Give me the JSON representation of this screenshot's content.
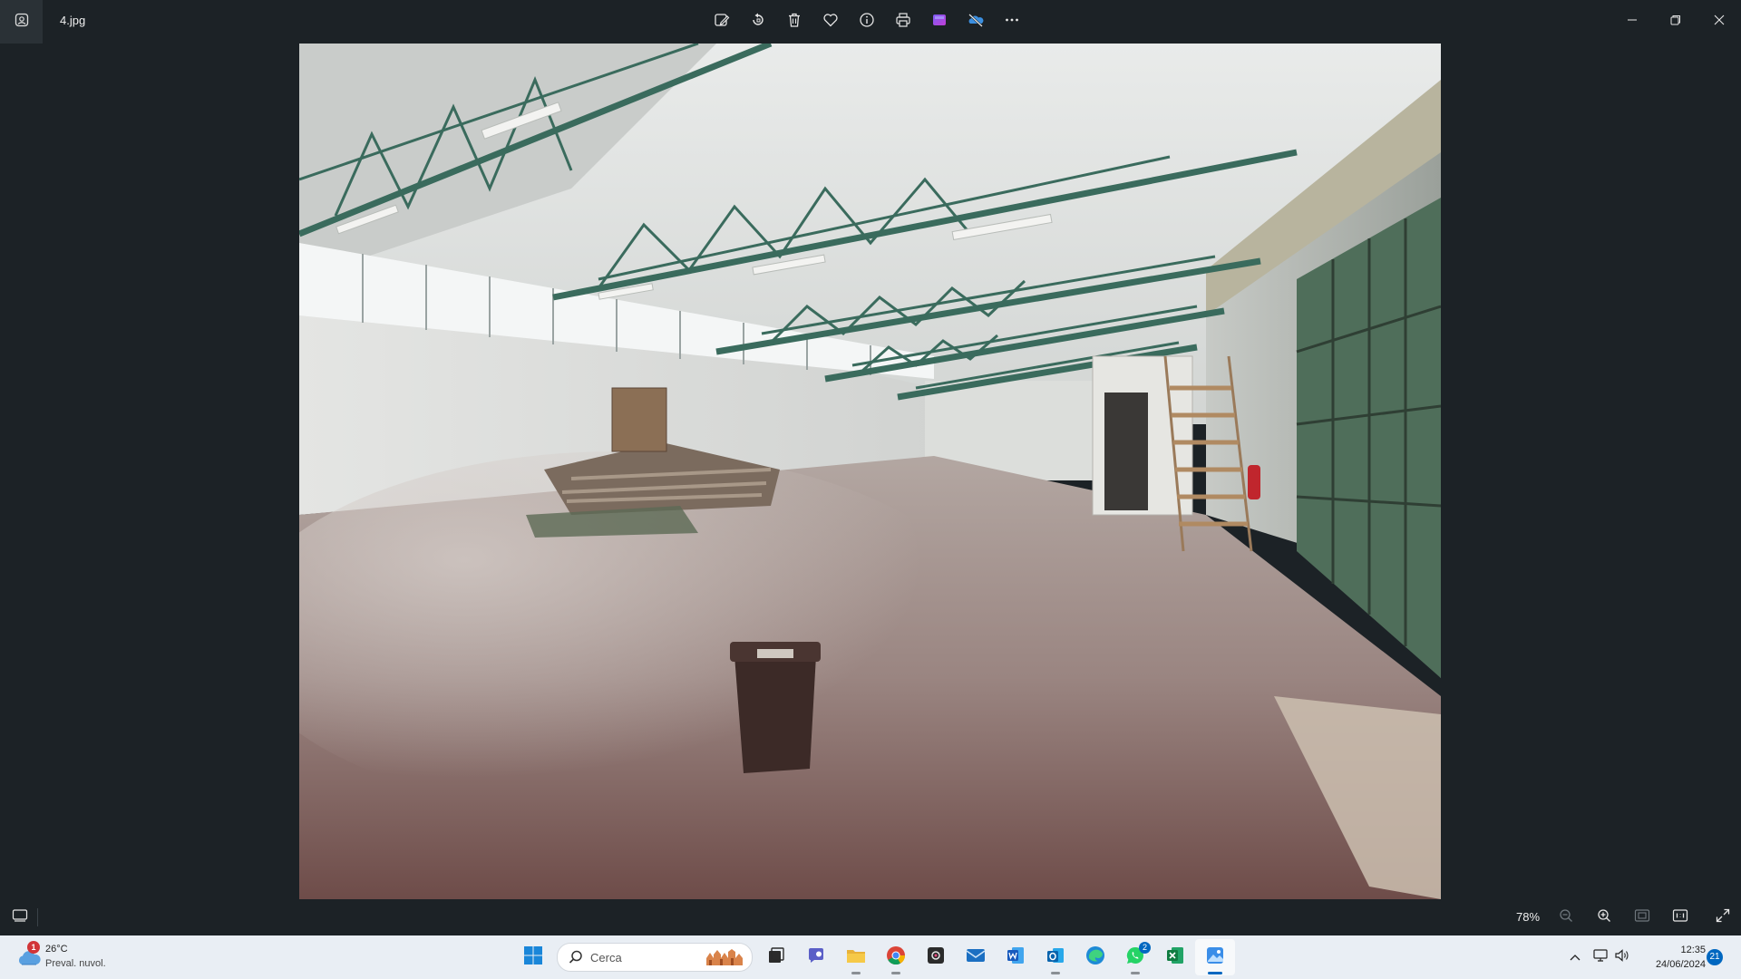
{
  "titlebar": {
    "file_name": "4.jpg",
    "toolbar": [
      {
        "name": "edit-image-button",
        "icon": "edit-image-icon"
      },
      {
        "name": "rotate-button",
        "icon": "rotate-icon"
      },
      {
        "name": "delete-button",
        "icon": "trash-icon"
      },
      {
        "name": "favorite-button",
        "icon": "heart-icon"
      },
      {
        "name": "file-info-button",
        "icon": "info-icon"
      },
      {
        "name": "print-button",
        "icon": "printer-icon"
      },
      {
        "name": "clipchamp-button",
        "icon": "clipchamp-icon"
      },
      {
        "name": "onedrive-button",
        "icon": "onedrive-off-icon"
      },
      {
        "name": "more-options-button",
        "icon": "more-icon"
      }
    ],
    "window_controls": [
      "minimize",
      "restore",
      "close"
    ]
  },
  "viewer": {
    "image": "photo of empty industrial warehouse interior with steel roof trusses",
    "zoom_label": "78%"
  },
  "taskbar": {
    "weather": {
      "badge": "1",
      "temperature": "26°C",
      "description": "Preval. nuvol."
    },
    "search_placeholder": "Cerca",
    "apps": [
      {
        "name": "start-button",
        "icon": "windows-logo-icon"
      },
      {
        "name": "task-view-button",
        "icon": "task-view-icon"
      },
      {
        "name": "teams-button",
        "icon": "teams-chat-icon"
      },
      {
        "name": "file-explorer-button",
        "icon": "folder-icon",
        "running": true
      },
      {
        "name": "chrome-button",
        "icon": "chrome-icon",
        "running": true
      },
      {
        "name": "camera-app-button",
        "icon": "camera-icon"
      },
      {
        "name": "mail-button",
        "icon": "mail-icon"
      },
      {
        "name": "word-button",
        "icon": "word-icon"
      },
      {
        "name": "outlook-button",
        "icon": "outlook-icon",
        "running": true
      },
      {
        "name": "edge-button",
        "icon": "edge-icon"
      },
      {
        "name": "whatsapp-button",
        "icon": "whatsapp-icon",
        "badge": "2",
        "running": true
      },
      {
        "name": "excel-button",
        "icon": "excel-icon"
      },
      {
        "name": "photos-button",
        "icon": "photos-icon",
        "active": true
      }
    ],
    "tray": {
      "time": "12:35",
      "date": "24/06/2024",
      "notifications": "21"
    }
  },
  "colors": {
    "background": "#1c2226",
    "taskbar": "#e9eef4",
    "accent": "#0067c0"
  }
}
